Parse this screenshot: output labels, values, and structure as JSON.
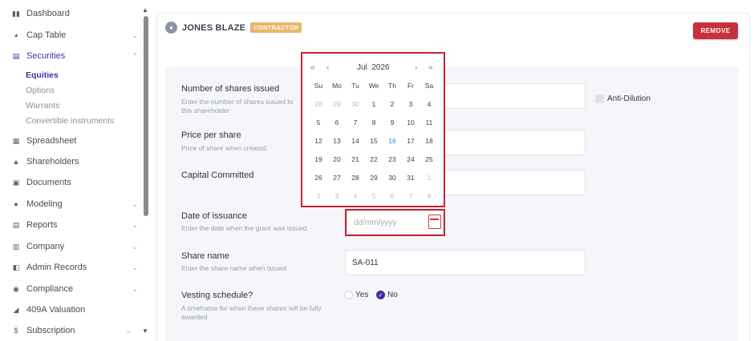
{
  "sidebar": {
    "items": [
      {
        "label": "Dashboard",
        "icon": "dashboard-icon",
        "has_chevron": false
      },
      {
        "label": "Cap Table",
        "icon": "pie-chart-icon",
        "has_chevron": true
      },
      {
        "label": "Securities",
        "icon": "clipboard-icon",
        "has_chevron": true,
        "active": true
      },
      {
        "label": "Spreadsheet",
        "icon": "spreadsheet-icon",
        "has_chevron": false
      },
      {
        "label": "Shareholders",
        "icon": "user-icon",
        "has_chevron": false
      },
      {
        "label": "Documents",
        "icon": "folder-icon",
        "has_chevron": false
      },
      {
        "label": "Modeling",
        "icon": "lightbulb-icon",
        "has_chevron": true
      },
      {
        "label": "Reports",
        "icon": "report-icon",
        "has_chevron": true
      },
      {
        "label": "Company",
        "icon": "building-icon",
        "has_chevron": true
      },
      {
        "label": "Admin Records",
        "icon": "records-icon",
        "has_chevron": true
      },
      {
        "label": "Compliance",
        "icon": "shield-icon",
        "has_chevron": true
      },
      {
        "label": "409A Valuation",
        "icon": "valuation-icon",
        "has_chevron": false
      },
      {
        "label": "Subscription",
        "icon": "dollar-icon",
        "has_chevron": true
      }
    ],
    "sub_items": [
      "Equities",
      "Options",
      "Warrants",
      "Convertible instruments"
    ],
    "active_sub": "Equities"
  },
  "header": {
    "holder_name": "JONES BLAZE",
    "badge": "CONTRACTOR",
    "remove_label": "REMOVE"
  },
  "form": {
    "shares": {
      "label": "Number of shares issued",
      "hint": "Enter the number of shares issued to this shareholder",
      "value": ""
    },
    "anti_dilution": {
      "label": "Anti-Dilution",
      "checked": false
    },
    "price": {
      "label": "Price per share",
      "hint": "Price of share when created",
      "value": ""
    },
    "capital": {
      "label": "Capital Committed",
      "value": ""
    },
    "date": {
      "label": "Date of issuance",
      "hint": "Enter the date when the grant was issued",
      "placeholder": "dd/mm/yyyy"
    },
    "share_name": {
      "label": "Share name",
      "hint": "Enter the share name when issued",
      "value": "SA-011"
    },
    "vesting": {
      "label": "Vesting schedule?",
      "hint": "A timeframe for when these shares will be fully awarded",
      "options": [
        "Yes",
        "No"
      ],
      "selected": "No"
    }
  },
  "calendar": {
    "month": "Jul",
    "year": "2026",
    "nav": {
      "prev_year": "«",
      "prev_month": "‹",
      "next_month": "›",
      "next_year": "»"
    },
    "weekdays": [
      "Su",
      "Mo",
      "Tu",
      "We",
      "Th",
      "Fr",
      "Sa"
    ],
    "weeks": [
      [
        "28",
        "29",
        "30",
        "1",
        "2",
        "3",
        "4"
      ],
      [
        "5",
        "6",
        "7",
        "8",
        "9",
        "10",
        "11"
      ],
      [
        "12",
        "13",
        "14",
        "15",
        "16",
        "17",
        "18"
      ],
      [
        "19",
        "20",
        "21",
        "22",
        "23",
        "24",
        "25"
      ],
      [
        "26",
        "27",
        "28",
        "29",
        "30",
        "31",
        "1"
      ],
      [
        "2",
        "3",
        "4",
        "5",
        "6",
        "7",
        "8"
      ]
    ],
    "today": "16",
    "colors": {
      "accent": "#4b2aa8",
      "today": "#2a8fd6",
      "highlight": "#c4262e"
    }
  }
}
